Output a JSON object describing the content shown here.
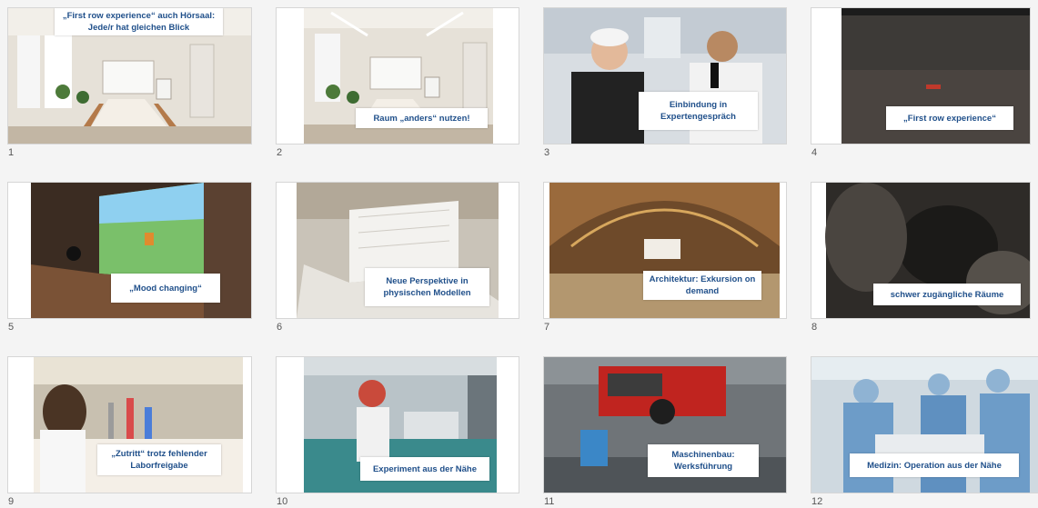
{
  "slides": [
    {
      "number": "1",
      "caption": "„First row experience“ auch Hörsaal: Jede/r hat gleichen Blick"
    },
    {
      "number": "2",
      "caption": "Raum „anders“ nutzen!"
    },
    {
      "number": "3",
      "caption": "Einbindung in Expertengespräch"
    },
    {
      "number": "4",
      "caption": "„First row experience“"
    },
    {
      "number": "5",
      "caption": "„Mood changing“"
    },
    {
      "number": "6",
      "caption": "Neue Perspektive in physischen Modellen"
    },
    {
      "number": "7",
      "caption": "Architektur: Exkursion on demand"
    },
    {
      "number": "8",
      "caption": "schwer zugängliche Räume"
    },
    {
      "number": "9",
      "caption": "„Zutritt“ trotz fehlender Laborfreigabe"
    },
    {
      "number": "10",
      "caption": "Experiment aus der Nähe"
    },
    {
      "number": "11",
      "caption": "Maschinenbau: Werksführung"
    },
    {
      "number": "12",
      "caption": "Medizin: Operation aus der Nähe"
    }
  ],
  "colors": {
    "caption_text": "#1f4f8a",
    "background": "#f4f4f4"
  }
}
